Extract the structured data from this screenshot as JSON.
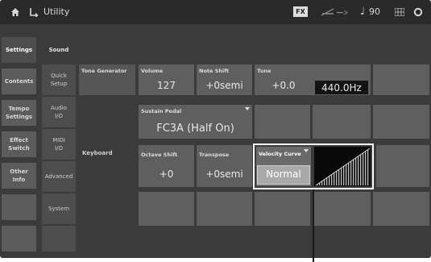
{
  "topbar": {
    "home_icon": "home-icon",
    "back_icon": "return-icon",
    "title": "Utility",
    "fx_badge": "FX",
    "meter_icon": "level-meter-icon",
    "note_glyph": "♩",
    "tempo": "90",
    "grid_icon": "grid-icon",
    "settings_icon": "ring-icon"
  },
  "sidebar": {
    "tabs": [
      {
        "label": "Settings",
        "active": true
      },
      {
        "label": "Contents"
      },
      {
        "label": "Tempo\nSettings"
      },
      {
        "label": "Effect\nSwitch"
      },
      {
        "label": "Other\nInfo"
      }
    ]
  },
  "subnav": {
    "items": [
      {
        "label": "Sound",
        "active": true
      },
      {
        "label": "Quick\nSetup"
      },
      {
        "label": "Audio\nI/O"
      },
      {
        "label": "MIDI\nI/O"
      },
      {
        "label": "Advanced"
      },
      {
        "label": "System"
      }
    ]
  },
  "tone_generator": {
    "section_label": "Tone Generator",
    "volume_label": "Volume",
    "volume_value": "127",
    "note_shift_label": "Note Shift",
    "note_shift_value": "+0semi",
    "tune_label": "Tune",
    "tune_value": "+0.0",
    "tune_hz": "440.0Hz",
    "sustain_label": "Sustain Pedal",
    "sustain_value": "FC3A (Half On)"
  },
  "keyboard": {
    "section_label": "Keyboard",
    "octave_label": "Octave Shift",
    "octave_value": "+0",
    "transpose_label": "Transpose",
    "transpose_value": "+0semi",
    "velocity_label": "Velocity Curve",
    "velocity_value": "Normal"
  }
}
